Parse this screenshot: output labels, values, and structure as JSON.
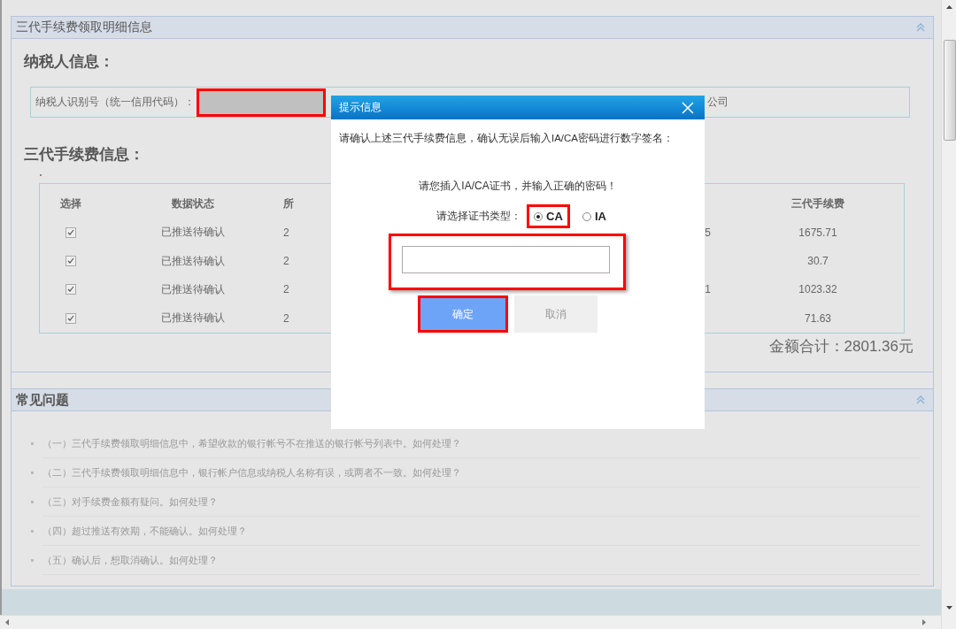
{
  "page_title": "三代手续费领取明细信息",
  "taxpayer": {
    "heading": "纳税人信息：",
    "id_label": "纳税人识别号（统一信用代码）：",
    "id_masked": true,
    "id_highlighted": true,
    "name_fragment": "公司"
  },
  "fees": {
    "heading": "三代手续费信息：",
    "header": {
      "select": "选择",
      "status": "数据状态",
      "column_3": "所",
      "fee": "三代手续费"
    },
    "rows": [
      {
        "checked": true,
        "status": "已推送待确认",
        "column_3": "2",
        "column_4": "5",
        "fee": "1675.71"
      },
      {
        "checked": true,
        "status": "已推送待确认",
        "column_3": "2",
        "column_4": "",
        "fee": "30.7"
      },
      {
        "checked": true,
        "status": "已推送待确认",
        "column_3": "2",
        "column_4": "1",
        "fee": "1023.32"
      },
      {
        "checked": true,
        "status": "已推送待确认",
        "column_3": "2",
        "column_4": "",
        "fee": "71.63"
      }
    ],
    "total": "金额合计：2801.36元"
  },
  "faq": {
    "title": "常见问题",
    "items": [
      "（一）三代手续费领取明细信息中，希望收款的银行帐号不在推送的银行帐号列表中。如何处理？",
      "（二）三代手续费领取明细信息中，银行帐户信息或纳税人名称有误，或两者不一致。如何处理？",
      "（三）对手续费金额有疑问。如何处理？",
      "（四）超过推送有效期，不能确认。如何处理？",
      "（五）确认后，想取消确认。如何处理？"
    ]
  },
  "dialog": {
    "title": "提示信息",
    "message": "请确认上述三代手续费信息，确认无误后输入IA/CA密码进行数字签名：",
    "prompt": "请您插入IA/CA证书，并输入正确的密码！",
    "cert_label": "请选择证书类型：",
    "cert_types": [
      {
        "label": "CA",
        "selected": true,
        "highlighted": true
      },
      {
        "label": "IA",
        "selected": false,
        "highlighted": false
      }
    ],
    "password": {
      "highlighted": true
    },
    "buttons": [
      {
        "label": "确定",
        "kind": "primary",
        "highlighted": true
      },
      {
        "label": "取消",
        "kind": "secondary",
        "highlighted": false
      }
    ]
  }
}
